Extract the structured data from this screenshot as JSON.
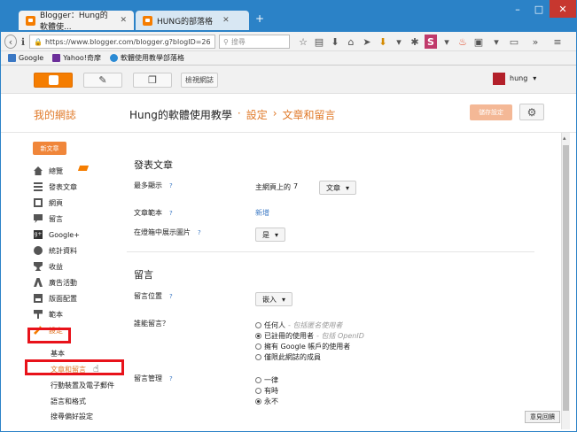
{
  "browser": {
    "tabs": [
      {
        "title": "Blogger：Hung的軟體使...",
        "active": true
      },
      {
        "title": "HUNG的部落格",
        "active": false
      }
    ],
    "url": "https://www.blogger.com/blogger.g?blogID=26",
    "search_placeholder": "搜尋",
    "bookmarks": [
      "Google",
      "Yahoo!奇摩",
      "軟體使用教學部落格"
    ]
  },
  "blogger_header": {
    "view_blog_label": "檢視網誌",
    "user_name": "hung"
  },
  "page_header": {
    "my_blogs_label": "我的網誌",
    "blog_name": "Hung的軟體使用教學",
    "separator": "·",
    "crumb_settings": "設定",
    "crumb_arrow": "›",
    "crumb_page": "文章和留言",
    "save_button": "儲存設定"
  },
  "sidebar": {
    "new_post_label": "新文章",
    "items": [
      {
        "label": "總覽",
        "icon": "home-icon"
      },
      {
        "label": "發表文章",
        "icon": "posts-icon"
      },
      {
        "label": "網頁",
        "icon": "pages-icon"
      },
      {
        "label": "留言",
        "icon": "comments-icon"
      },
      {
        "label": "Google+",
        "icon": "google-plus-icon"
      },
      {
        "label": "統計資料",
        "icon": "stats-icon"
      },
      {
        "label": "收益",
        "icon": "trophy-icon"
      },
      {
        "label": "廣告活動",
        "icon": "campaign-icon"
      },
      {
        "label": "版面配置",
        "icon": "layout-icon"
      },
      {
        "label": "範本",
        "icon": "template-icon"
      },
      {
        "label": "設定",
        "icon": "wrench-icon"
      }
    ],
    "sub_items": [
      "基本",
      "文章和留言",
      "行動裝置及電子郵件",
      "語言和格式",
      "搜尋偏好設定"
    ]
  },
  "main": {
    "posts_section_title": "發表文章",
    "show_at_most_label": "最多顯示",
    "help_mark": "?",
    "show_at_most_prefix": "主網頁上的",
    "show_at_most_value": "7",
    "show_unit_dropdown": "文章",
    "post_template_label": "文章範本",
    "post_template_action": "新增",
    "lightbox_label": "在燈箱中展示圖片",
    "lightbox_value": "是",
    "comments_section_title": "留言",
    "comment_location_label": "留言位置",
    "comment_location_value": "嵌入",
    "who_can_comment_label": "誰能留言？",
    "who_can_comment_options": [
      {
        "label": "任何人",
        "hint": "- 包括匿名使用者",
        "checked": false
      },
      {
        "label": "已註冊的使用者",
        "hint": "- 包括 OpenID",
        "checked": true
      },
      {
        "label": "擁有 Google 帳戶的使用者",
        "hint": "",
        "checked": false
      },
      {
        "label": "僅限此網誌的成員",
        "hint": "",
        "checked": false
      }
    ],
    "moderation_label": "留言管理",
    "moderation_options": [
      {
        "label": "一律",
        "checked": false
      },
      {
        "label": "有時",
        "checked": false
      },
      {
        "label": "永不",
        "checked": true
      }
    ]
  },
  "feedback_button": "意見回饋",
  "colors": {
    "accent": "#f57d00",
    "link": "#3b78c4",
    "highlight": "#e8121a",
    "titlebar": "#2b82c7"
  }
}
